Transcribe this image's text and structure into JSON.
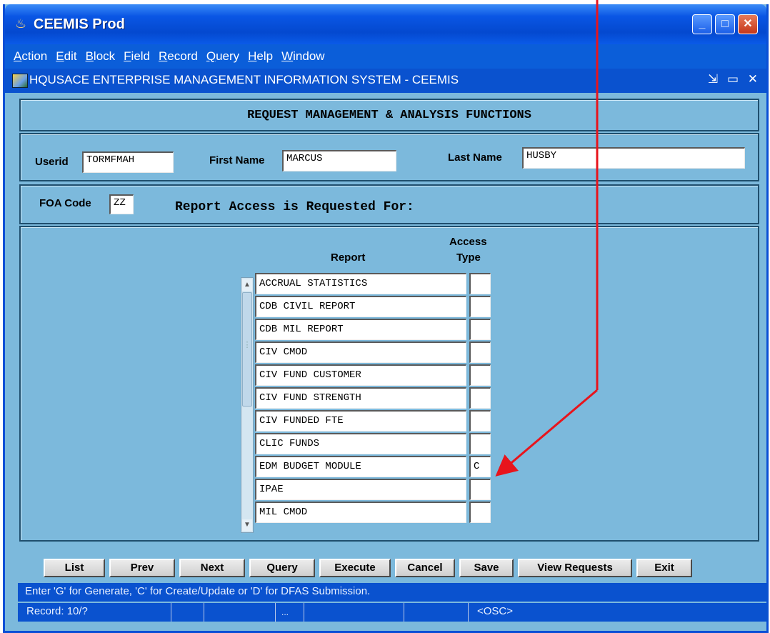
{
  "window": {
    "title": "CEEMIS Prod",
    "controls": {
      "minimize": "_",
      "maximize": "□",
      "close": "✕"
    }
  },
  "menu": [
    "Action",
    "Edit",
    "Block",
    "Field",
    "Record",
    "Query",
    "Help",
    "Window"
  ],
  "subwindow": {
    "title": "HQUSACE ENTERPRISE MANAGEMENT INFORMATION SYSTEM - CEEMIS",
    "controls": "⇲ ▭ ✕"
  },
  "form": {
    "header": "REQUEST MANAGEMENT & ANALYSIS FUNCTIONS",
    "userid_label": "Userid",
    "userid": "TORMFMAH",
    "firstname_label": "First Name",
    "firstname": "MARCUS",
    "lastname_label": "Last Name",
    "lastname": "HUSBY",
    "foa_label": "FOA Code",
    "foa": "ZZ",
    "access_heading": "Report Access is Requested For:",
    "col_report": "Report",
    "col_access_1": "Access",
    "col_access_2": "Type"
  },
  "reports": [
    {
      "name": "ACCRUAL STATISTICS",
      "access": ""
    },
    {
      "name": "CDB CIVIL REPORT",
      "access": ""
    },
    {
      "name": "CDB MIL REPORT",
      "access": ""
    },
    {
      "name": "CIV CMOD",
      "access": ""
    },
    {
      "name": "CIV FUND CUSTOMER",
      "access": ""
    },
    {
      "name": "CIV FUND STRENGTH",
      "access": ""
    },
    {
      "name": "CIV FUNDED FTE",
      "access": ""
    },
    {
      "name": "CLIC FUNDS",
      "access": ""
    },
    {
      "name": "EDM BUDGET MODULE",
      "access": "C"
    },
    {
      "name": "IPAE",
      "access": ""
    },
    {
      "name": "MIL CMOD",
      "access": ""
    }
  ],
  "buttons": [
    "List",
    "Prev",
    "Next",
    "Query",
    "Execute",
    "Cancel",
    "Save",
    "View Requests",
    "Exit"
  ],
  "status": {
    "hint": "Enter 'G' for Generate, 'C' for Create/Update or 'D' for DFAS Submission.",
    "record": "Record: 10/?",
    "ellipsis": "...",
    "osc": "<OSC>"
  },
  "colors": {
    "annotation_arrow": "#e8141c",
    "form_background": "#7cb9dc",
    "titlebar": "#0a56e5"
  }
}
